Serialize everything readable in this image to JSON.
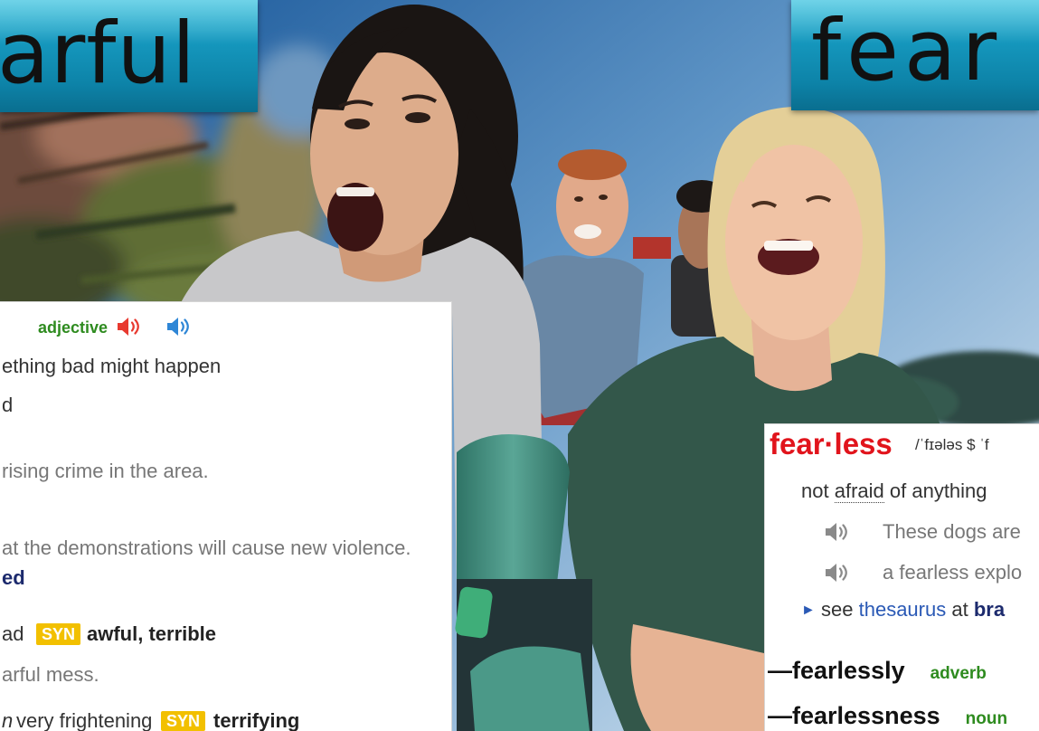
{
  "colors": {
    "banner_teal": "#1597bd",
    "headword_red": "#e1141c",
    "pos_green": "#2e8b1f",
    "link_blue": "#2a59b5",
    "syn_yellow": "#f2c000",
    "phrase_navy": "#1c2a6d",
    "example_gray": "#777777",
    "speaker_red": "#e8392f",
    "speaker_blue": "#2e86d6",
    "speaker_gray": "#8a8a8a"
  },
  "icons": {
    "speaker": "speaker-icon",
    "arrow": "triangle-right-icon"
  },
  "banners": {
    "left_title": "arful",
    "right_title": "fear"
  },
  "left_entry": {
    "part_of_speech": "adjective",
    "definition_1": "ething bad might happen",
    "definition_1_cont": "d",
    "example_1": "rising crime in the area.",
    "example_2": "at the demonstrations will cause new violence.",
    "phrase": "ed",
    "definition_2": "ad",
    "definition_2_syn_label": "SYN",
    "definition_2_synonyms": "awful, terrible",
    "example_3": "arful mess.",
    "definition_3_register": "n",
    "definition_3": "very frightening",
    "definition_3_syn_label": "SYN",
    "definition_3_synonyms": "terrifying"
  },
  "right_entry": {
    "headword": "fear·less",
    "pronunciation": "/ˈfɪələs $ ˈf",
    "definition": {
      "before": "not",
      "link": "afraid",
      "after": "of anything"
    },
    "examples": [
      "These dogs are",
      "a fearless explo"
    ],
    "thesaurus": {
      "arrow": "►",
      "see": "see",
      "link": "thesaurus",
      "at": "at",
      "target": "bra"
    },
    "derived": [
      {
        "word": "—fearlessly",
        "pos": "adverb"
      },
      {
        "word": "—fearlessness",
        "pos": "noun"
      }
    ]
  }
}
